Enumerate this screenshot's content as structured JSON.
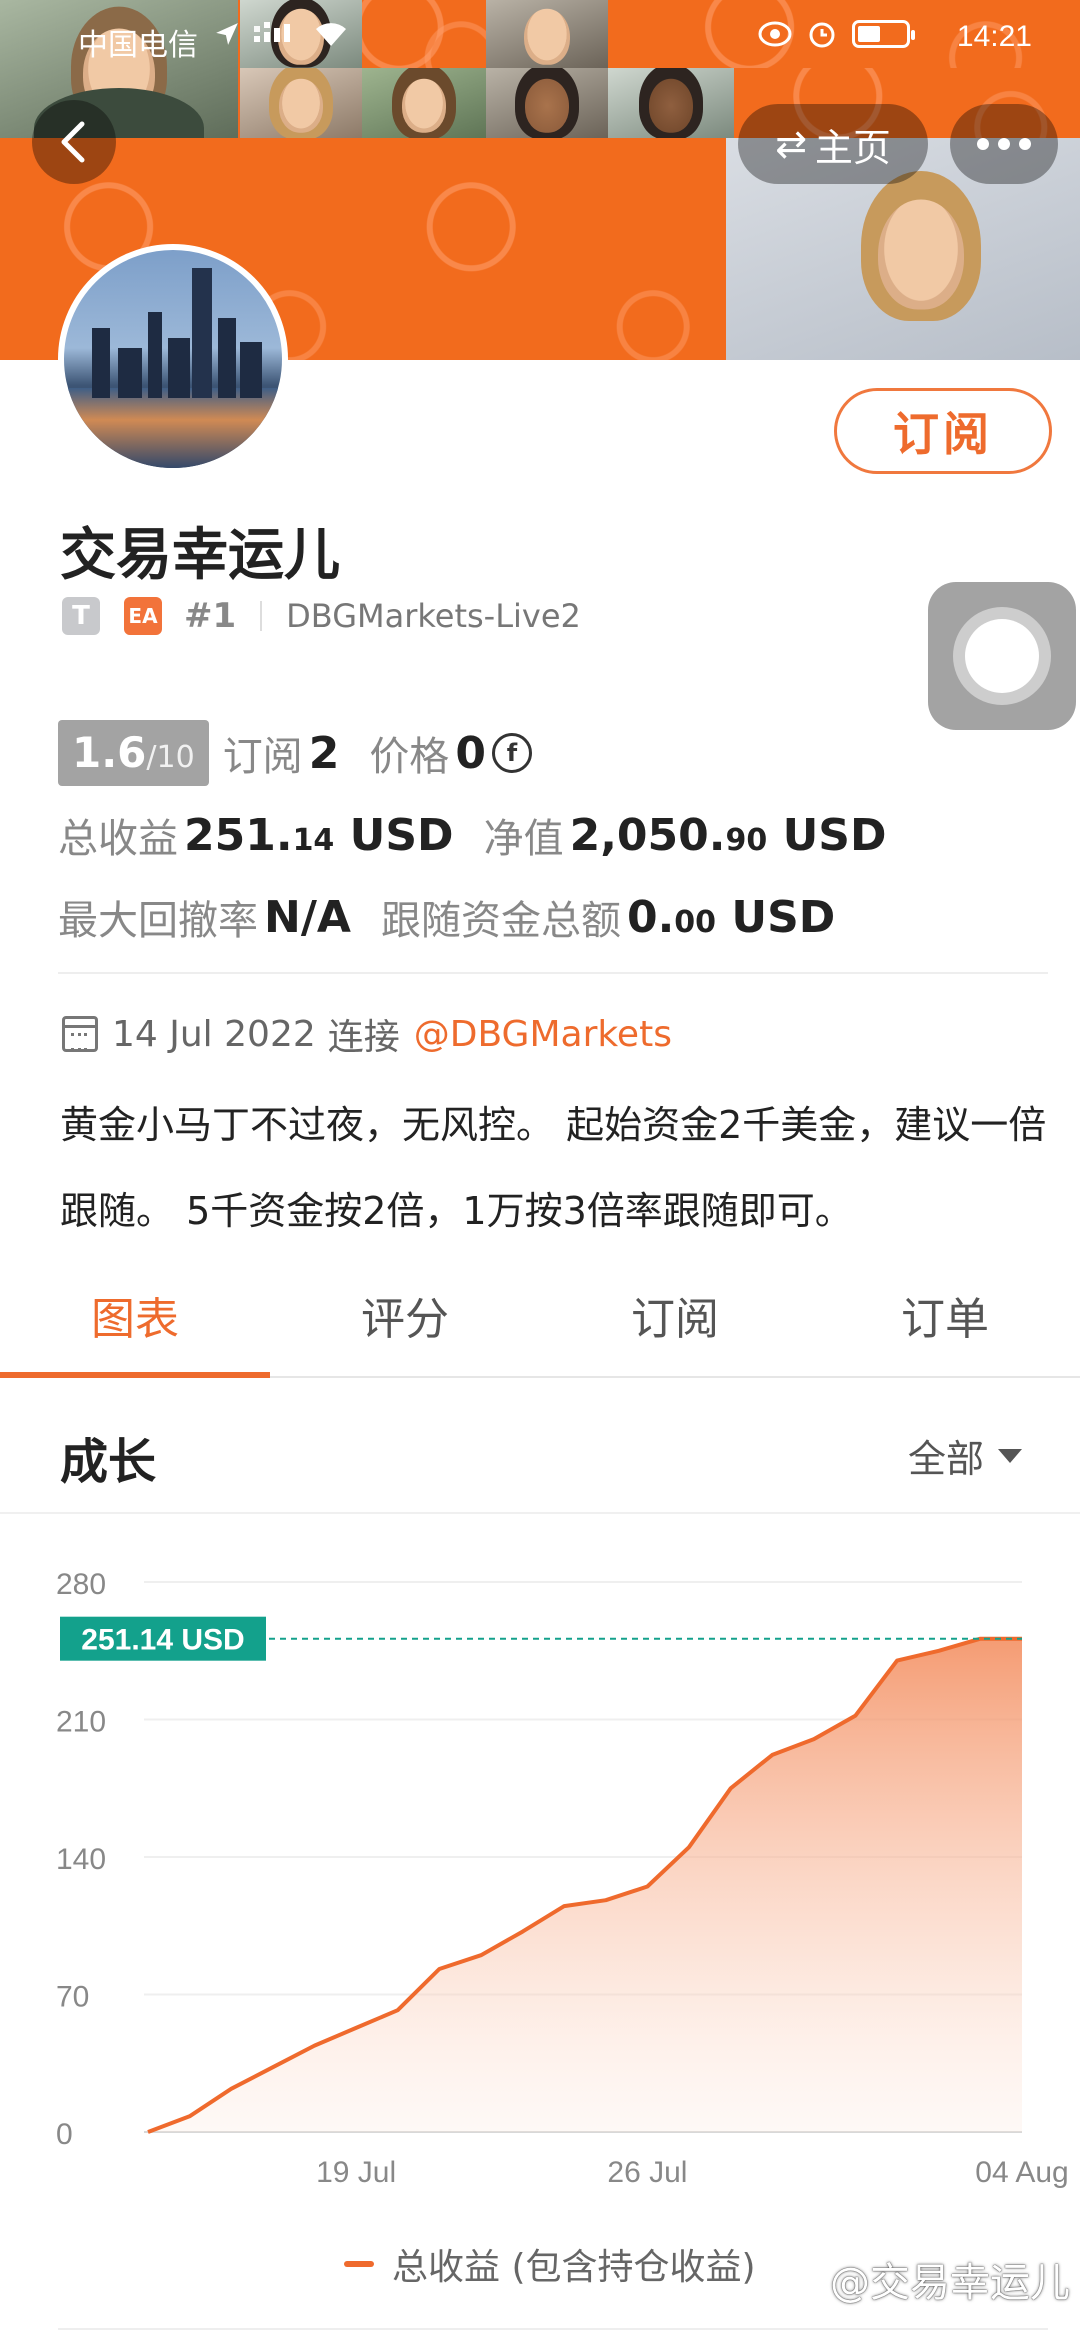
{
  "status_bar": {
    "carrier": "中国电信",
    "time": "14:21"
  },
  "nav": {
    "home_label": "主页",
    "swap_icon": "⇄"
  },
  "profile": {
    "name": "交易幸运儿",
    "tag_t": "T",
    "tag_ea": "EA",
    "rank": "#1",
    "server": "DBGMarkets-Live2",
    "subscribe_label": "订阅"
  },
  "stats": {
    "score": "1.6",
    "score_den": "/10",
    "subscribers_label": "订阅",
    "subscribers": "2",
    "price_label": "价格",
    "price": "0",
    "coin_icon": "f",
    "total_profit_label": "总收益",
    "total_profit_int": "251.",
    "total_profit_dec": "14",
    "total_profit_unit": "USD",
    "equity_label": "净值",
    "equity_int": "2,050.",
    "equity_dec": "90",
    "equity_unit": "USD",
    "drawdown_label": "最大回撤率",
    "drawdown": "N/A",
    "follow_label": "跟随资金总额",
    "follow_int": "0.",
    "follow_dec": "00",
    "follow_unit": "USD"
  },
  "connection": {
    "date": "14 Jul 2022",
    "connect_label": "连接",
    "broker": "@DBGMarkets"
  },
  "description": "黄金小马丁不过夜，无风控。 起始资金2千美金，建议一倍跟随。 5千资金按2倍，1万按3倍率跟随即可。",
  "tabs": [
    "图表",
    "评分",
    "订阅",
    "订单"
  ],
  "section": {
    "title": "成长",
    "filter": "全部"
  },
  "chart_data": {
    "type": "area",
    "title": "",
    "x_ticks": [
      "19 Jul",
      "26 Jul",
      "04 Aug"
    ],
    "y_ticks": [
      0,
      70,
      140,
      210,
      280
    ],
    "ylim": [
      0,
      280
    ],
    "current_label": "251.14 USD",
    "current_value": 251.14,
    "series": [
      {
        "name": "总收益 (包含持仓收益)",
        "color": "#ef6a2d",
        "x": [
          "2022-07-14",
          "2022-07-15",
          "2022-07-16",
          "2022-07-17",
          "2022-07-18",
          "2022-07-19",
          "2022-07-20",
          "2022-07-21",
          "2022-07-22",
          "2022-07-23",
          "2022-07-24",
          "2022-07-25",
          "2022-07-26",
          "2022-07-27",
          "2022-07-28",
          "2022-07-29",
          "2022-07-30",
          "2022-07-31",
          "2022-08-01",
          "2022-08-02",
          "2022-08-03",
          "2022-08-04"
        ],
        "values": [
          0,
          8,
          22,
          33,
          44,
          53,
          62,
          83,
          90,
          102,
          115,
          118,
          125,
          145,
          175,
          192,
          200,
          212,
          240,
          245,
          251.14,
          251.14
        ]
      }
    ]
  },
  "legend_label": "总收益 (包含持仓收益)",
  "watermark": "@交易幸运儿",
  "colors": {
    "accent": "#ee6b2d",
    "teal": "#13a18c"
  }
}
